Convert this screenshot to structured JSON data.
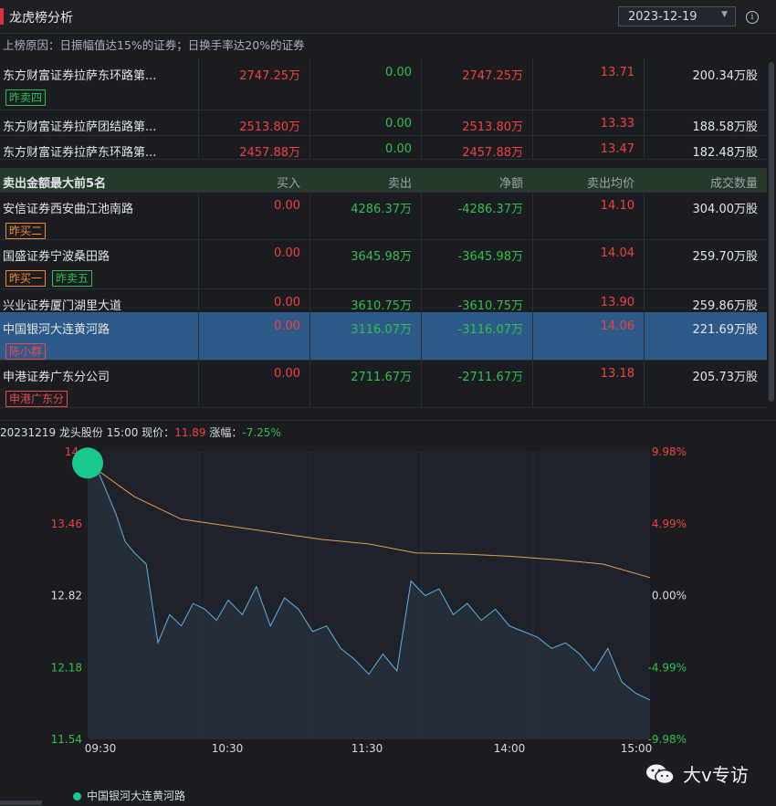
{
  "header": {
    "title": "龙虎榜分析",
    "date": "2023-12-19",
    "info": "i"
  },
  "reason": "上榜原因：日振幅值达15%的证券；日换手率达20%的证券",
  "buy_rows": [
    {
      "name": "东方财富证券拉萨东环路第...",
      "buy": "2747.25万",
      "sell": "0.00",
      "net": "2747.25万",
      "avg": "13.71",
      "vol": "200.34万股",
      "tags": [
        {
          "text": "昨卖四",
          "kind": "green-tag"
        }
      ]
    },
    {
      "name": "东方财富证券拉萨团结路第...",
      "buy": "2513.80万",
      "sell": "0.00",
      "net": "2513.80万",
      "avg": "13.33",
      "vol": "188.58万股",
      "tags": []
    },
    {
      "name": "东方财富证券拉萨东环路第...",
      "buy": "2457.88万",
      "sell": "0.00",
      "net": "2457.88万",
      "avg": "13.47",
      "vol": "182.48万股",
      "tags": []
    }
  ],
  "sell_header": {
    "title": "卖出金额最大前5名",
    "buy": "买入",
    "sell": "卖出",
    "net": "净额",
    "avg": "卖出均价",
    "vol": "成交数量"
  },
  "sell_rows": [
    {
      "name": "安信证券西安曲江池南路",
      "buy": "0.00",
      "sell": "4286.37万",
      "net": "-4286.37万",
      "avg": "14.10",
      "vol": "304.00万股",
      "tags": [
        {
          "text": "昨买二",
          "kind": "orange-tag"
        }
      ]
    },
    {
      "name": "国盛证券宁波桑田路",
      "buy": "0.00",
      "sell": "3645.98万",
      "net": "-3645.98万",
      "avg": "14.04",
      "vol": "259.70万股",
      "tags": [
        {
          "text": "昨买一",
          "kind": "orange-tag"
        },
        {
          "text": "昨卖五",
          "kind": "green-tag"
        }
      ]
    },
    {
      "name": "兴业证券厦门湖里大道",
      "buy": "0.00",
      "sell": "3610.75万",
      "net": "-3610.75万",
      "avg": "13.90",
      "vol": "259.86万股",
      "tags": []
    },
    {
      "name": "中国银河大连黄河路",
      "buy": "0.00",
      "sell": "3116.07万",
      "net": "-3116.07万",
      "avg": "14.06",
      "vol": "221.69万股",
      "tags": [
        {
          "text": "陈小群",
          "kind": "red-tag"
        }
      ],
      "selected": true
    },
    {
      "name": "申港证券广东分公司",
      "buy": "0.00",
      "sell": "2711.67万",
      "net": "-2711.67万",
      "avg": "13.18",
      "vol": "205.73万股",
      "tags": [
        {
          "text": "申港广东分",
          "kind": "red-tag"
        }
      ]
    }
  ],
  "chart_info": {
    "date": "20231219",
    "stock": "龙头股份",
    "time": "15:00",
    "price_label": "现价：",
    "price": "11.89",
    "change_label": "涨幅：",
    "change": "-7.25%"
  },
  "chart_data": {
    "type": "line",
    "title": "",
    "x_ticks": [
      "09:30",
      "10:30",
      "11:30",
      "14:00",
      "15:00"
    ],
    "y_left_ticks": [
      "14.",
      "13.46",
      "12.82",
      "12.18",
      "11.54"
    ],
    "y_right_ticks": [
      "9.98%",
      "4.99%",
      "0.00%",
      "-4.99%",
      "-9.98%"
    ],
    "ylim": [
      11.54,
      14.1
    ],
    "prev_close": 12.82,
    "series": [
      {
        "name": "",
        "color": "#5aaee6",
        "x": [
          0,
          4,
          8,
          12,
          16,
          20,
          25,
          30,
          35,
          40,
          45,
          50,
          55,
          60,
          66,
          72,
          78,
          84,
          90,
          96,
          102,
          108,
          114,
          120,
          126,
          132,
          138,
          144,
          150,
          156,
          162,
          168,
          174,
          180,
          186,
          192,
          198,
          204,
          210,
          216,
          222,
          228,
          234,
          240
        ],
        "y": [
          14.0,
          13.95,
          13.75,
          13.55,
          13.3,
          13.2,
          13.1,
          12.4,
          12.65,
          12.55,
          12.75,
          12.7,
          12.6,
          12.78,
          12.65,
          12.9,
          12.55,
          12.8,
          12.7,
          12.5,
          12.55,
          12.35,
          12.25,
          12.12,
          12.3,
          12.15,
          12.95,
          12.82,
          12.88,
          12.65,
          12.75,
          12.6,
          12.7,
          12.55,
          12.5,
          12.45,
          12.35,
          12.4,
          12.3,
          12.15,
          12.35,
          12.05,
          11.95,
          11.89
        ]
      },
      {
        "name": "",
        "color": "#e0a050",
        "x": [
          0,
          20,
          40,
          60,
          80,
          100,
          120,
          140,
          160,
          180,
          200,
          220,
          240
        ],
        "y": [
          14.0,
          13.7,
          13.5,
          13.44,
          13.38,
          13.32,
          13.28,
          13.2,
          13.19,
          13.17,
          13.14,
          13.1,
          12.98
        ]
      }
    ],
    "marker": {
      "series": "中国银河大连黄河路",
      "x": 0,
      "y": 14.0,
      "color": "#17c98e"
    }
  },
  "legend": {
    "label": "中国银河大连黄河路"
  },
  "watermark": {
    "text": "大v专访"
  }
}
